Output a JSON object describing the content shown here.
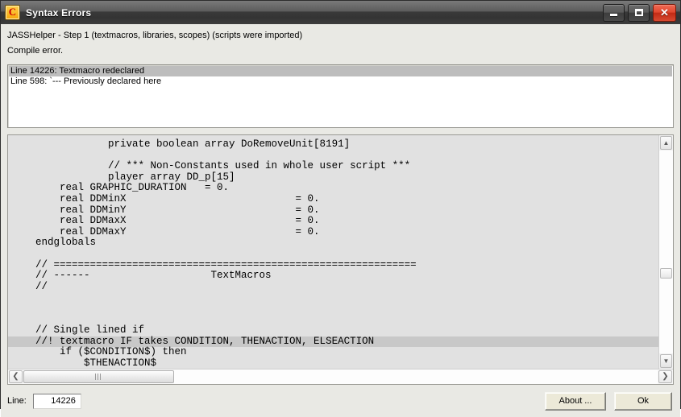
{
  "window": {
    "title": "Syntax Errors",
    "icon": "compiler-c-icon",
    "caption_buttons": {
      "minimize": "minimize-icon",
      "maximize": "maximize-icon",
      "close": "close-icon",
      "close_glyph": "✕"
    }
  },
  "status": {
    "line1": "JASSHelper - Step 1 (textmacros, libraries, scopes) (scripts were imported)",
    "line2": "Compile error."
  },
  "errors": [
    {
      "text": "Line 14226: Textmacro redeclared",
      "selected": true
    },
    {
      "text": "Line 598: `--- Previously declared here",
      "selected": false
    }
  ],
  "code": {
    "lines": [
      {
        "text": "                private boolean array DoRemoveUnit[8191]",
        "highlight": false
      },
      {
        "text": "",
        "highlight": false
      },
      {
        "text": "                // *** Non-Constants used in whole user script ***",
        "highlight": false
      },
      {
        "text": "                player array DD_p[15]",
        "highlight": false
      },
      {
        "text": "        real GRAPHIC_DURATION   = 0.",
        "highlight": false
      },
      {
        "text": "        real DDMinX                            = 0.",
        "highlight": false
      },
      {
        "text": "        real DDMinY                            = 0.",
        "highlight": false
      },
      {
        "text": "        real DDMaxX                            = 0.",
        "highlight": false
      },
      {
        "text": "        real DDMaxY                            = 0.",
        "highlight": false
      },
      {
        "text": "    endglobals",
        "highlight": false
      },
      {
        "text": "",
        "highlight": false
      },
      {
        "text": "    // ============================================================",
        "highlight": false
      },
      {
        "text": "    // ------                    TextMacros",
        "highlight": false
      },
      {
        "text": "    //",
        "highlight": false
      },
      {
        "text": "",
        "highlight": false
      },
      {
        "text": "",
        "highlight": false
      },
      {
        "text": "",
        "highlight": false
      },
      {
        "text": "    // Single lined if",
        "highlight": false
      },
      {
        "text": "    //! textmacro IF takes CONDITION, THENACTION, ELSEACTION",
        "highlight": true
      },
      {
        "text": "        if ($CONDITION$) then",
        "highlight": false
      },
      {
        "text": "            $THENACTION$",
        "highlight": false
      }
    ],
    "scrollbars": {
      "up_arrow": "▲",
      "down_arrow": "▼",
      "left_arrow": "❮",
      "right_arrow": "❯"
    }
  },
  "bottom": {
    "line_label": "Line:",
    "line_value": "14226",
    "about_label": "About ...",
    "ok_label": "Ok"
  },
  "colors": {
    "selection": "#bdbdbd",
    "code_highlight": "#c8c8c8",
    "code_background": "#e1e1e1",
    "dialog_background": "#e9e9e4",
    "close_button": "#c22b15",
    "icon_background": "#f5a60a"
  }
}
